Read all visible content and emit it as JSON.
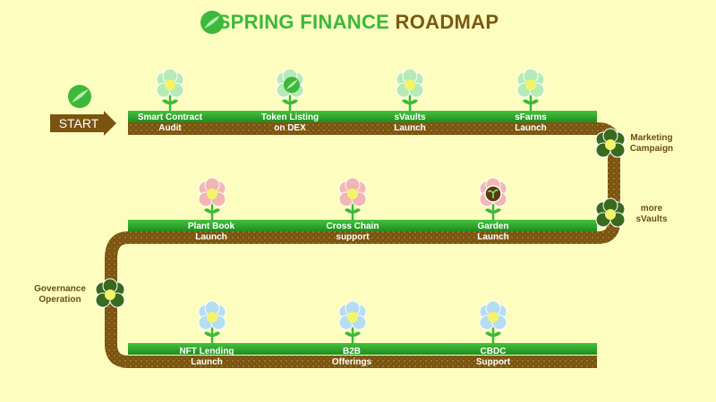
{
  "title": {
    "part1": "SPRING FINANCE",
    "part2": "ROADMAP"
  },
  "start_label": "START",
  "milestones": [
    {
      "line1": "Smart Contract",
      "line2": "Audit"
    },
    {
      "line1": "Token Listing",
      "line2": "on DEX"
    },
    {
      "line1": "sVaults",
      "line2": "Launch"
    },
    {
      "line1": "sFarms",
      "line2": "Launch"
    },
    {
      "line1": "Plant Book",
      "line2": "Launch"
    },
    {
      "line1": "Cross Chain",
      "line2": "support"
    },
    {
      "line1": "Garden",
      "line2": "Launch"
    },
    {
      "line1": "NFT Lending",
      "line2": "Launch"
    },
    {
      "line1": "B2B",
      "line2": "Offerings"
    },
    {
      "line1": "CBDC",
      "line2": "Support"
    }
  ],
  "side_steps": [
    {
      "line1": "Marketing",
      "line2": "Campaign"
    },
    {
      "line1": "more",
      "line2": "sVaults"
    },
    {
      "line1": "Governance",
      "line2": "Operation"
    }
  ],
  "colors": {
    "background": "#fdfdc0",
    "title_green": "#3db83a",
    "title_brown": "#7a5a10",
    "grass": "#2fa52c",
    "soil": "#7a5410",
    "flower_green": "#b5eab8",
    "flower_pink": "#f2b4b4",
    "flower_blue": "#b4dcf5",
    "clover_dark": "#3a6a1e"
  },
  "icons": [
    "spring-logo-icon",
    "flower-icon",
    "clover-icon",
    "start-arrow-icon"
  ]
}
